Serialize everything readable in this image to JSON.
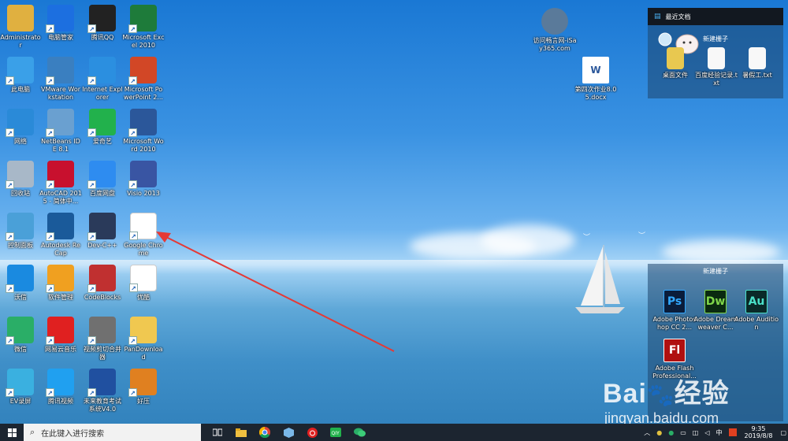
{
  "desktop_icons": [
    {
      "label": "Administrator",
      "icon": "user-folder-icon",
      "color": "#e0b040"
    },
    {
      "label": "电脑管家",
      "icon": "tencent-pc-manager-icon",
      "color": "#1c6fe0"
    },
    {
      "label": "腾讯QQ",
      "icon": "qq-penguin-icon",
      "color": "#222222"
    },
    {
      "label": "Microsoft Excel 2010",
      "icon": "excel-icon",
      "color": "#1e7b3a"
    },
    {
      "label": "此电脑",
      "icon": "this-pc-icon",
      "color": "#3aa0e8"
    },
    {
      "label": "VMware Workstation",
      "icon": "vmware-icon",
      "color": "#3a7fc0"
    },
    {
      "label": "Internet Explorer",
      "icon": "internet-explorer-icon",
      "color": "#2b8fe0"
    },
    {
      "label": "Microsoft PowerPoint 2...",
      "icon": "powerpoint-icon",
      "color": "#d24726"
    },
    {
      "label": "网络",
      "icon": "network-icon",
      "color": "#2a8ad8"
    },
    {
      "label": "NetBeans IDE 8.1",
      "icon": "netbeans-icon",
      "color": "#6aa0d0"
    },
    {
      "label": "爱奇艺",
      "icon": "iqiyi-icon",
      "color": "#22b14c"
    },
    {
      "label": "Microsoft Word 2010",
      "icon": "word-icon",
      "color": "#2b579a"
    },
    {
      "label": "回收站",
      "icon": "recycle-bin-icon",
      "color": "#a8b8c8"
    },
    {
      "label": "AutoCAD 2015 - 简体中...",
      "icon": "autocad-icon",
      "color": "#c8102e"
    },
    {
      "label": "百度网盘",
      "icon": "baidu-netdisk-icon",
      "color": "#2e8cf0"
    },
    {
      "label": "Visio 2013",
      "icon": "visio-icon",
      "color": "#3955a3"
    },
    {
      "label": "控制面板",
      "icon": "control-panel-icon",
      "color": "#4aa0d8"
    },
    {
      "label": "Autodesk ReCap",
      "icon": "autodesk-recap-icon",
      "color": "#1a5a9a"
    },
    {
      "label": "Dev-C++",
      "icon": "dev-cpp-icon",
      "color": "#2a3a5a"
    },
    {
      "label": "Google Chrome",
      "icon": "chrome-icon",
      "color": "#ffffff"
    },
    {
      "label": "沃信",
      "icon": "nk-icon",
      "color": "#1a8ae0"
    },
    {
      "label": "软件管理",
      "icon": "software-manager-icon",
      "color": "#f0a020"
    },
    {
      "label": "CodeBlocks",
      "icon": "codeblocks-icon",
      "color": "#c03030"
    },
    {
      "label": "优酷",
      "icon": "youku-icon",
      "color": "#ffffff"
    },
    {
      "label": "微信",
      "icon": "wechat-icon",
      "color": "#2aae67"
    },
    {
      "label": "网易云音乐",
      "icon": "netease-music-icon",
      "color": "#e02020"
    },
    {
      "label": "视频剪切合并器",
      "icon": "video-cutter-icon",
      "color": "#707070"
    },
    {
      "label": "PanDownload",
      "icon": "pandownload-folder-icon",
      "color": "#f0c850"
    },
    {
      "label": "EV录屏",
      "icon": "ev-recorder-icon",
      "color": "#3ab0e0"
    },
    {
      "label": "腾讯视频",
      "icon": "tencent-video-icon",
      "color": "#20a0f0"
    },
    {
      "label": "未来教育考试系统V4.0",
      "icon": "future-education-icon",
      "color": "#2050a0"
    },
    {
      "label": "好压",
      "icon": "haozip-icon",
      "color": "#e08020"
    }
  ],
  "extra_icons": [
    {
      "label": "访问畅言网-iSay365.com",
      "icon": "isay-globe-icon"
    },
    {
      "label": "第四次作业8.05.docx",
      "icon": "word-doc-icon"
    }
  ],
  "recent_panel": {
    "title": "最近文档",
    "subtitle": "新建栅子",
    "items": [
      {
        "label": "桌面文件",
        "icon": "folder-icon"
      },
      {
        "label": "百度经验记录.txt",
        "icon": "txt-file-icon"
      },
      {
        "label": "暑假工.txt",
        "icon": "txt-file-icon"
      }
    ]
  },
  "fence_panel": {
    "title": "新建栅子",
    "items": [
      {
        "label": "Adobe Photoshop CC 2...",
        "abbr": "Ps",
        "bg": "#0a1c3a",
        "fg": "#31a8ff"
      },
      {
        "label": "Adobe Dreamweaver C...",
        "abbr": "Dw",
        "bg": "#0a2a10",
        "fg": "#7fd64a"
      },
      {
        "label": "Adobe Audition",
        "abbr": "Au",
        "bg": "#0a2a28",
        "fg": "#4ae0c8"
      },
      {
        "label": "Adobe Flash Professional...",
        "abbr": "Fl",
        "bg": "#b01010",
        "fg": "#ffffff"
      }
    ]
  },
  "taskbar": {
    "search_placeholder": "在此键入进行搜索",
    "apps": [
      "task-view-icon",
      "file-explorer-icon",
      "chrome-icon",
      "box-icon",
      "netease-music-icon",
      "iqiyi-icon",
      "wechat-icon"
    ],
    "tray_text": "中",
    "time": "9:35",
    "date": "2019/8/8"
  },
  "watermark": {
    "brand": "Bai",
    "brand_suffix": "经验",
    "url": "jingyan.baidu.com"
  }
}
